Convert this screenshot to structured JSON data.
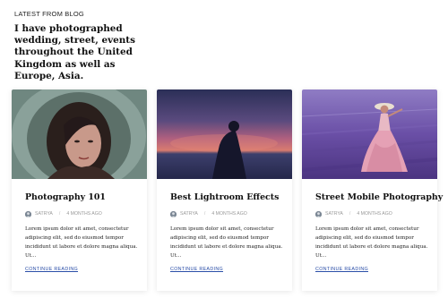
{
  "section": {
    "label": "LATEST FROM BLOG",
    "headline": "I have photographed wedding, street, events throughout the United Kingdom as well as Europe, Asia."
  },
  "posts": [
    {
      "title": "Photography 101",
      "author": "SATRYA",
      "time": "4 MONTHS AGO",
      "excerpt": "Lorem ipsum dolor sit amet, consectetur adipiscing elit, sed do eiusmod tempor incididunt ut labore et dolore magna aliqua. Ut...",
      "read_more": "CONTINUE READING",
      "image": "portrait-fur-hood"
    },
    {
      "title": "Best Lightroom Effects",
      "author": "SATRYA",
      "time": "4 MONTHS AGO",
      "excerpt": "Lorem ipsum dolor sit amet, consectetur adipiscing elit, sed do eiusmod tempor incididunt ut labore et dolore magna aliqua. Ut...",
      "read_more": "CONTINUE READING",
      "image": "silhouette-sunset"
    },
    {
      "title": "Street Mobile Photography",
      "author": "SATRYA",
      "time": "4 MONTHS AGO",
      "excerpt": "Lorem ipsum dolor sit amet, consectetur adipiscing elit, sed do eiusmod tempor incididunt ut labore et dolore magna aliqua. Ut...",
      "read_more": "CONTINUE READING",
      "image": "lavender-field-woman"
    }
  ],
  "colors": {
    "link": "#2b4fa8",
    "meta": "#999999",
    "title": "#111111"
  }
}
